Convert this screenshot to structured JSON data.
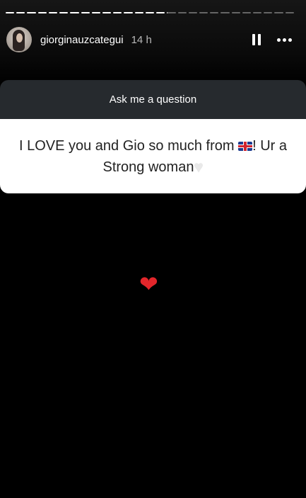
{
  "story": {
    "username": "giorginauzcategui",
    "time_ago": "14 h",
    "segments_done": 15,
    "segments_total": 27,
    "current_segment_progress": 0.08
  },
  "question_sticker": {
    "prompt": "Ask me a question",
    "answer_part1": "I LOVE you and Gio so much from ",
    "answer_part2": "! Ur a Strong woman",
    "flag_icon": "uk-flag-icon",
    "heart_icon": "white-heart-icon"
  },
  "sticker": {
    "glyph": "❤",
    "icon": "red-heart-icon",
    "color": "#e3262b"
  },
  "controls": {
    "pause_icon": "pause-icon",
    "more_icon": "more-options-icon"
  }
}
